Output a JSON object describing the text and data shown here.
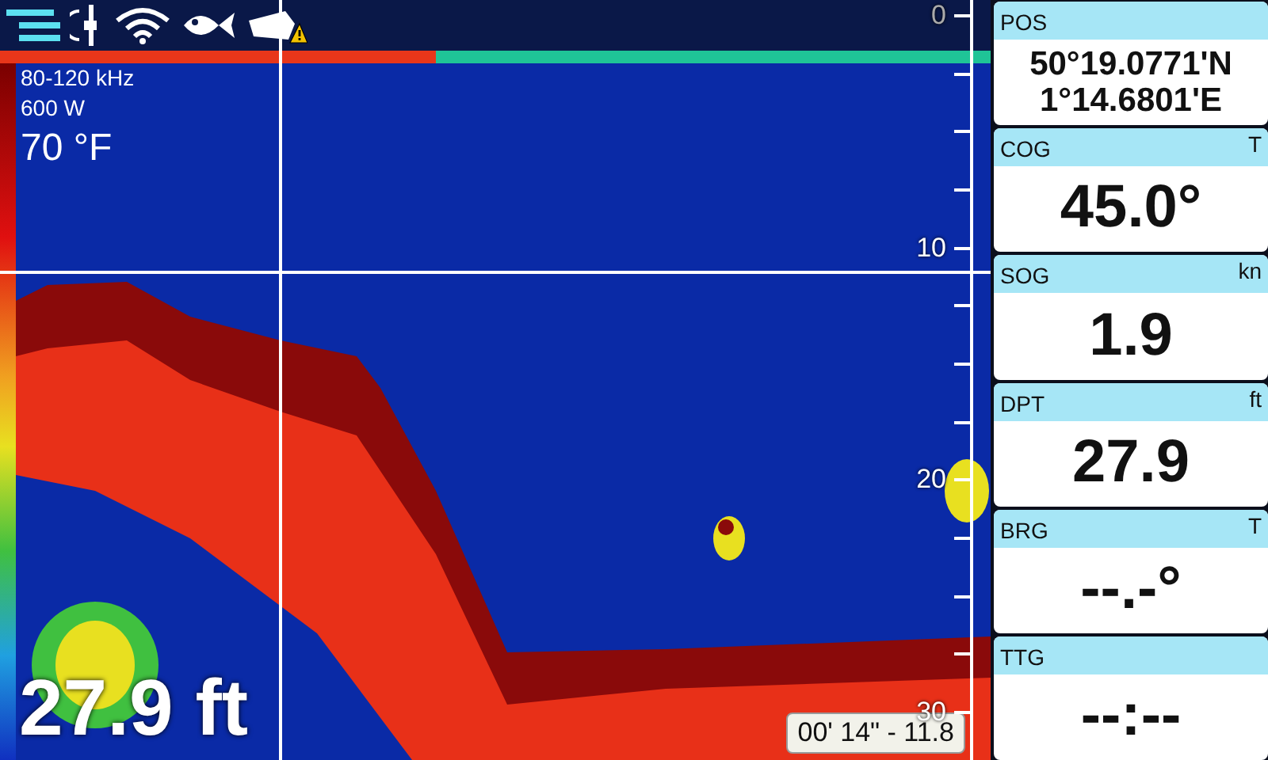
{
  "history_bar": {
    "level": 0.44
  },
  "sonar": {
    "frequency": "80-120 kHz",
    "power": "600 W",
    "water_temp": "70 °F",
    "depth": "27.9 ft",
    "cursor_readout": "00' 14\" - 11.8",
    "scale": [
      "0",
      "10",
      "20",
      "30"
    ]
  },
  "data_panels": [
    {
      "label": "POS",
      "lines": [
        "50°19.0771'N",
        "1°14.6801'E"
      ]
    },
    {
      "label": "COG",
      "unit": "T",
      "lines": [
        "45.0°"
      ]
    },
    {
      "label": "SOG",
      "unit": "kn",
      "lines": [
        "1.9"
      ]
    },
    {
      "label": "DPT",
      "unit": "ft",
      "lines": [
        "27.9"
      ]
    },
    {
      "label": "BRG",
      "unit": "T",
      "lines": [
        "--.-°"
      ]
    },
    {
      "label": "TTG",
      "lines": [
        "--:--"
      ]
    }
  ]
}
